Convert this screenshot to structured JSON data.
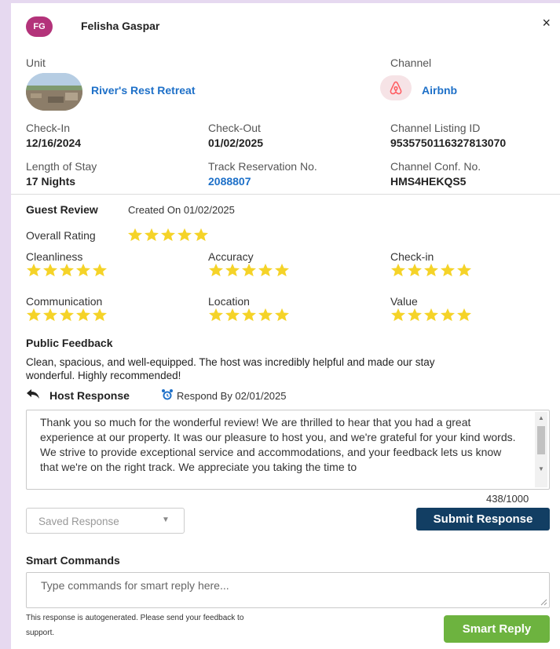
{
  "guest": {
    "initials": "FG",
    "name": "Felisha Gaspar"
  },
  "header": {
    "close_symbol": "×"
  },
  "unit": {
    "label": "Unit",
    "name": "River's Rest Retreat"
  },
  "channel": {
    "label": "Channel",
    "name": "Airbnb",
    "icon": "airbnb-icon"
  },
  "details": {
    "check_in_label": "Check-In",
    "check_in": "12/16/2024",
    "check_out_label": "Check-Out",
    "check_out": "01/02/2025",
    "listing_id_label": "Channel Listing ID",
    "listing_id": "953575011632781307​0",
    "stay_label": "Length of Stay",
    "stay": "17 Nights",
    "track_label": "Track Reservation No.",
    "track": "2088807",
    "conf_label": "Channel Conf. No.",
    "conf": "HMS4HEKQS5"
  },
  "review": {
    "title": "Guest Review",
    "created": "Created On 01/02/2025",
    "overall_label": "Overall Rating",
    "overall_stars": 5,
    "categories": [
      {
        "label": "Cleanliness",
        "stars": 5
      },
      {
        "label": "Accuracy",
        "stars": 5
      },
      {
        "label": "Check-in",
        "stars": 5
      },
      {
        "label": "Communication",
        "stars": 5
      },
      {
        "label": "Location",
        "stars": 5
      },
      {
        "label": "Value",
        "stars": 5
      }
    ],
    "star_color": "#f5d328"
  },
  "feedback": {
    "title": "Public Feedback",
    "text_line1": "Clean, spacious, and well-equipped. The host was incredibly helpful and made our stay",
    "text_line2": "wonderful. Highly recommended!"
  },
  "host_response": {
    "title": "Host Response",
    "respond_by": "Respond By 02/01/2025",
    "text": "Thank you so much for the wonderful review! We are thrilled to hear that you had a great experience at our property. It was our pleasure to host you, and we're grateful for your kind words. We strive to provide exceptional service and accommodations, and your feedback lets us know that we're on the right track. We appreciate you taking the time to",
    "char_count": "438/1000"
  },
  "saved_response": {
    "placeholder": "Saved Response"
  },
  "submit_label": "Submit Response",
  "smart_commands": {
    "title": "Smart Commands",
    "placeholder": "Type commands for smart reply here...",
    "note_line1": "This response is autogenerated. Please send your feedback to",
    "note_line2": "support.",
    "button_label": "Smart Reply"
  },
  "colors": {
    "brand_dark": "#123e63",
    "link": "#1e70c8",
    "success": "#6db33f",
    "avatar": "#b3337a"
  }
}
